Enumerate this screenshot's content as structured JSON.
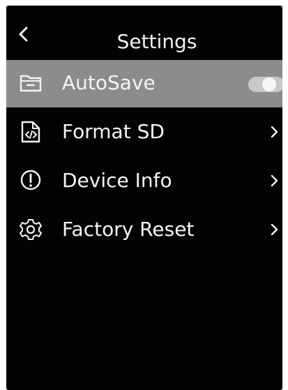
{
  "header": {
    "title": "Settings",
    "back_icon": "chevron-left-icon"
  },
  "menu": {
    "items": [
      {
        "label": "AutoSave",
        "icon": "folder-icon",
        "selected": true,
        "control": "toggle",
        "toggle_on": true
      },
      {
        "label": "Format SD",
        "icon": "sd-card-icon",
        "selected": false,
        "control": "chevron-right-icon"
      },
      {
        "label": "Device Info",
        "icon": "info-icon",
        "selected": false,
        "control": "chevron-right-icon"
      },
      {
        "label": "Factory Reset",
        "icon": "gear-icon",
        "selected": false,
        "control": "chevron-right-icon"
      }
    ]
  },
  "colors": {
    "background": "#030303",
    "selected_row": "#8c8c8c",
    "text": "#f4f4f4",
    "toggle_track": "#c9c9c9"
  }
}
